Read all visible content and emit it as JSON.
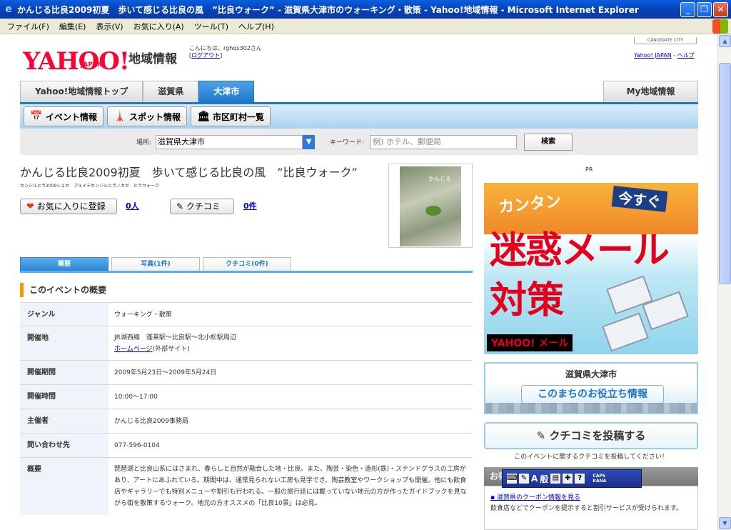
{
  "window": {
    "title": "かんじる比良2009初夏　歩いて感じる比良の風　”比良ウォーク” - 滋賀県大津市のウォーキング・散策 - Yahoo!地域情報 - Microsoft Internet Explorer"
  },
  "menu": [
    "ファイル(F)",
    "編集(E)",
    "表示(V)",
    "お気に入り(A)",
    "ツール(T)",
    "ヘルプ(H)"
  ],
  "header": {
    "logo_text": "YAHOO!",
    "logo_sub": "JAPAN",
    "section_title": "地域情報",
    "greeting": "こんにちは、rghqs302さん",
    "logout": "ログアウト",
    "candidate_city": "CANDIDATE CITY",
    "link_yahoo": "Yahoo! JAPAN",
    "link_help": "ヘルプ"
  },
  "breadcrumb": [
    "Yahoo!地域情報トップ",
    "滋賀県",
    "大津市"
  ],
  "my_tab": "My地域情報",
  "subnav": [
    {
      "icon": "calendar-icon",
      "label": "イベント情報"
    },
    {
      "icon": "tower-icon",
      "label": "スポット情報"
    },
    {
      "icon": "building-icon",
      "label": "市区町村一覧"
    }
  ],
  "search": {
    "place_label": "場所:",
    "place_value": "滋賀県大津市",
    "keyword_label": "キーワード:",
    "keyword_placeholder": "例) ホテル、郵便局",
    "button": "検索"
  },
  "event": {
    "title": "かんじる比良2009初夏　歩いて感じる比良の風　”比良ウォーク”",
    "kana": "カンジルヒラ2009ショカ　アルイテカンジルヒラノカゼ　ヒラウォーク",
    "favorite_button": "お気に入りに登録",
    "favorite_count": "0人",
    "kuchikomi_button": "クチコミ",
    "kuchikomi_count": "0件",
    "poster_text": "かんじる"
  },
  "tabs": [
    "概要",
    "写真(1件)",
    "クチコミ(0件)"
  ],
  "overview_heading": "このイベントの概要",
  "details": [
    {
      "key": "ジャンル",
      "value": "ウォーキング・散策"
    },
    {
      "key": "開催地",
      "value": "JR湖西線　蓬莱駅〜比良駅〜北小松駅周辺",
      "link": "ホームページ",
      "link_note": "(外部サイト)"
    },
    {
      "key": "開催期間",
      "value": "2009年5月23日〜2009年5月24日"
    },
    {
      "key": "開催時間",
      "value": "10:00〜17:00"
    },
    {
      "key": "主催者",
      "value": "かんじる比良2009事務局"
    },
    {
      "key": "問い合わせ先",
      "value": "077-596-0104"
    },
    {
      "key": "概要",
      "value": "琵琶湖と比良山系にはさまれ、春らしと自然が融合した地・比良。また、陶芸・染色・造形(鉄)・ステンドグラスの工房があり、アートにあふれている。期間中は、通常見られない工房も見学でき、陶芸教室やワークショップも開催。他にも飲食店やギャラリーでも特別メニューや割引も行われる。一般の旅行誌には載っていない地元の方が作ったガイドブックを見ながら街を散策するウォーク。地元の方オススメの「比良10景」は必見。"
    }
  ],
  "sidebar": {
    "pr": "PR",
    "banner_l1": "カンタン",
    "banner_l2": "今すぐ",
    "banner_l3": "迷惑メール",
    "banner_l4": "対策",
    "banner_brand": "YAHOO! メール",
    "city_title": "滋賀県大津市",
    "city_button": "このまちのお役立ち情報",
    "post_button": "クチコミを投稿する",
    "post_note": "このイベントに関するクチコミを投稿してください！",
    "deals_heading": "お得な情報",
    "deal_link": "滋賀県のクーポン情報を見る",
    "deal_text": "飲食店などでクーポンを提示すると割引サービスが受けられます。"
  },
  "ime": {
    "mode": "般",
    "caps": "CAPS",
    "kana": "KANA"
  }
}
